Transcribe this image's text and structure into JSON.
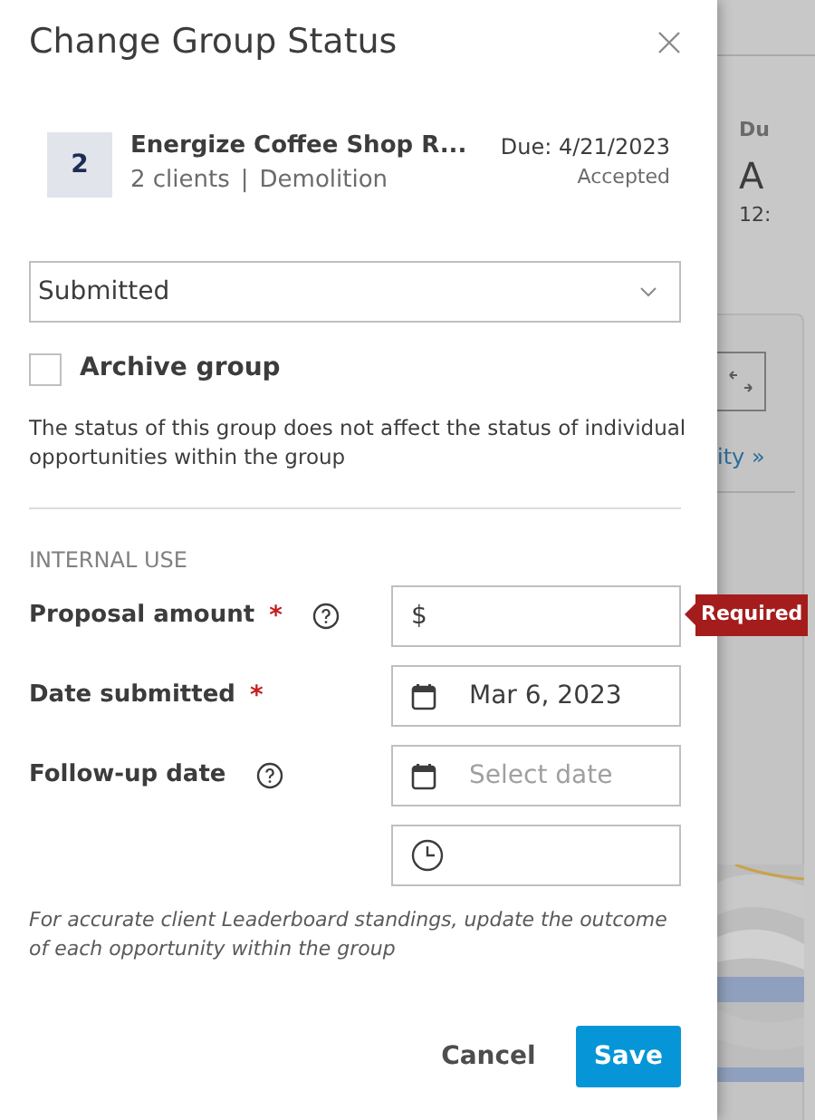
{
  "dialog": {
    "title": "Change Group Status",
    "group": {
      "count": "2",
      "name": "Energize Coffee Shop R...",
      "clients": "2 clients",
      "separator": "|",
      "trade": "Demolition",
      "due": "Due: 4/21/2023",
      "status": "Accepted"
    },
    "status_select": {
      "value": "Submitted"
    },
    "archive": {
      "label": "Archive group",
      "checked": false
    },
    "note": "The status of this group does not affect the status of individual opportunities within the group",
    "section_title": "INTERNAL USE",
    "fields": [
      {
        "kind": "money",
        "label": "Proposal amount",
        "required": true,
        "help": true,
        "prefix": "$",
        "error": "Required"
      },
      {
        "kind": "date",
        "label": "Date submitted",
        "required": true,
        "help": false,
        "value": "Mar 6, 2023"
      },
      {
        "kind": "date",
        "label": "Follow-up date",
        "required": false,
        "help": true,
        "placeholder": "Select date"
      },
      {
        "kind": "time"
      }
    ],
    "required_mark": "*",
    "footer_note": "For accurate client Leaderboard standings, update the outcome of each opportunity within the group",
    "buttons": [
      {
        "label": "Cancel",
        "kind": "secondary"
      },
      {
        "label": "Save",
        "kind": "primary"
      }
    ]
  },
  "background": {
    "label": "Du",
    "value": "A",
    "time": "12:",
    "link": "ity »"
  }
}
